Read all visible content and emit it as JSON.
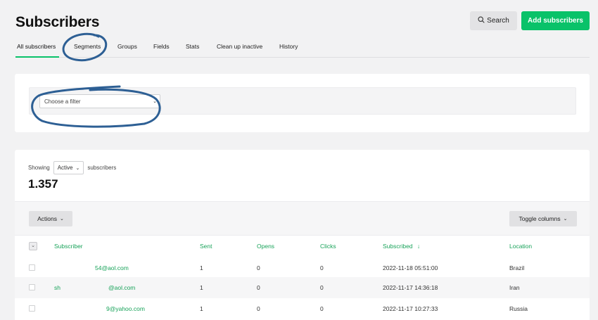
{
  "header": {
    "title": "Subscribers",
    "search_label": "Search",
    "add_label": "Add subscribers"
  },
  "tabs": [
    {
      "label": "All subscribers",
      "active": true
    },
    {
      "label": "Segments"
    },
    {
      "label": "Groups"
    },
    {
      "label": "Fields"
    },
    {
      "label": "Stats"
    },
    {
      "label": "Clean up inactive"
    },
    {
      "label": "History"
    }
  ],
  "filter": {
    "placeholder": "Choose a filter"
  },
  "list": {
    "showing_label": "Showing",
    "status_value": "Active",
    "subscribers_label": "subscribers",
    "count": "1.357",
    "actions_label": "Actions",
    "toggle_columns_label": "Toggle columns",
    "columns": [
      "Subscriber",
      "Sent",
      "Opens",
      "Clicks",
      "Subscribed",
      "Location"
    ],
    "sort_indicator": "↓",
    "rows": [
      {
        "subscriber": "54@aol.com",
        "sent": "1",
        "opens": "0",
        "clicks": "0",
        "subscribed": "2022-11-18 05:51:00",
        "location": "Brazil"
      },
      {
        "subscriber_prefix": "sh",
        "subscriber": "@aol.com",
        "sent": "1",
        "opens": "0",
        "clicks": "0",
        "subscribed": "2022-11-17 14:36:18",
        "location": "Iran"
      },
      {
        "subscriber": "9@yahoo.com",
        "sent": "1",
        "opens": "0",
        "clicks": "0",
        "subscribed": "2022-11-17 10:27:33",
        "location": "Russia"
      }
    ]
  },
  "colors": {
    "accent": "#09c269",
    "link": "#19a35a",
    "annotation": "#2d5f94"
  }
}
